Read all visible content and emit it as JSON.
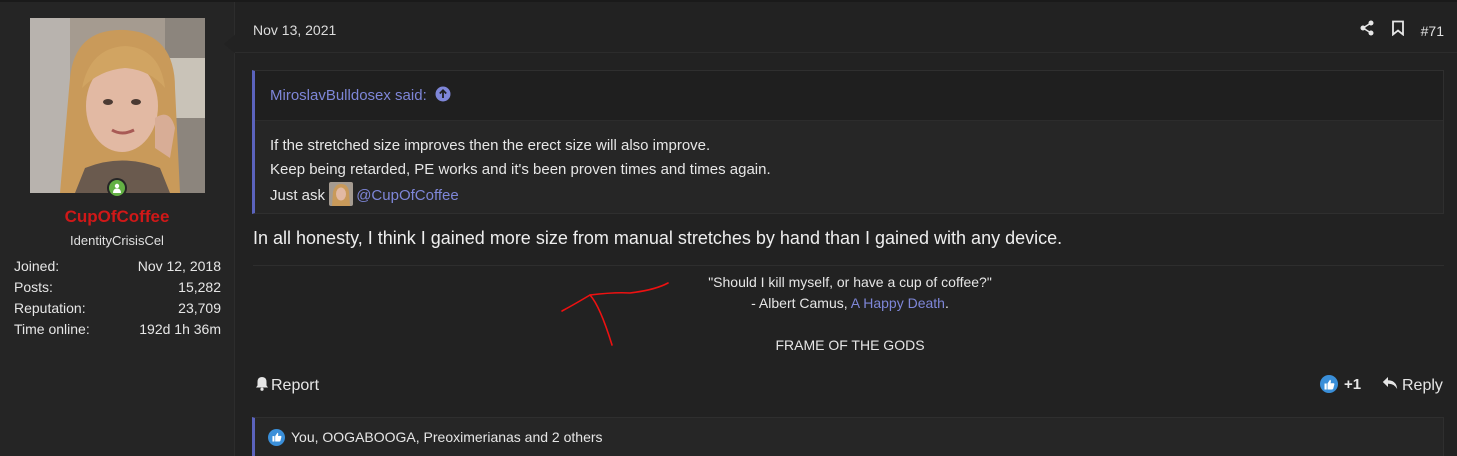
{
  "user": {
    "name": "CupOfCoffee",
    "title": "IdentityCrisisCel",
    "stats": [
      {
        "label": "Joined:",
        "value": "Nov 12, 2018"
      },
      {
        "label": "Posts:",
        "value": "15,282"
      },
      {
        "label": "Reputation:",
        "value": "23,709"
      },
      {
        "label": "Time online:",
        "value": "192d 1h 36m"
      }
    ]
  },
  "post": {
    "date": "Nov 13, 2021",
    "number": "#71",
    "quote": {
      "author_line": "MiroslavBulldosex said:",
      "lines": [
        "If the stretched size improves then the erect size will also improve.",
        "Keep being retarded, PE works and it's been proven times and times again."
      ],
      "last_line_prefix": "Just ask",
      "mention": "@CupOfCoffee"
    },
    "text": "In all honesty, I think I gained more size from manual stretches by hand than I gained with any device."
  },
  "signature": {
    "line1": "\"Should I kill myself, or have a cup of coffee?\"",
    "line2_prefix": "- Albert Camus,",
    "line2_link": "A Happy Death",
    "line2_suffix": ".",
    "line3": "FRAME OF THE GODS"
  },
  "footer": {
    "report_label": "Report",
    "like_count": "+1",
    "reply_label": "Reply",
    "reactions_text": "You, OOGABOOGA, Preoximerianas and 2 others"
  },
  "colors": {
    "background": "#222222",
    "username": "#d01818",
    "link": "#7e86d8",
    "quote_border": "#5b63bd",
    "online": "#63b044",
    "like": "#3a8fd9"
  },
  "icons": [
    "share-icon",
    "bookmark-icon",
    "arrow-up-circle-icon",
    "bell-icon",
    "thumbs-up-icon",
    "reply-icon",
    "user-online-icon"
  ]
}
